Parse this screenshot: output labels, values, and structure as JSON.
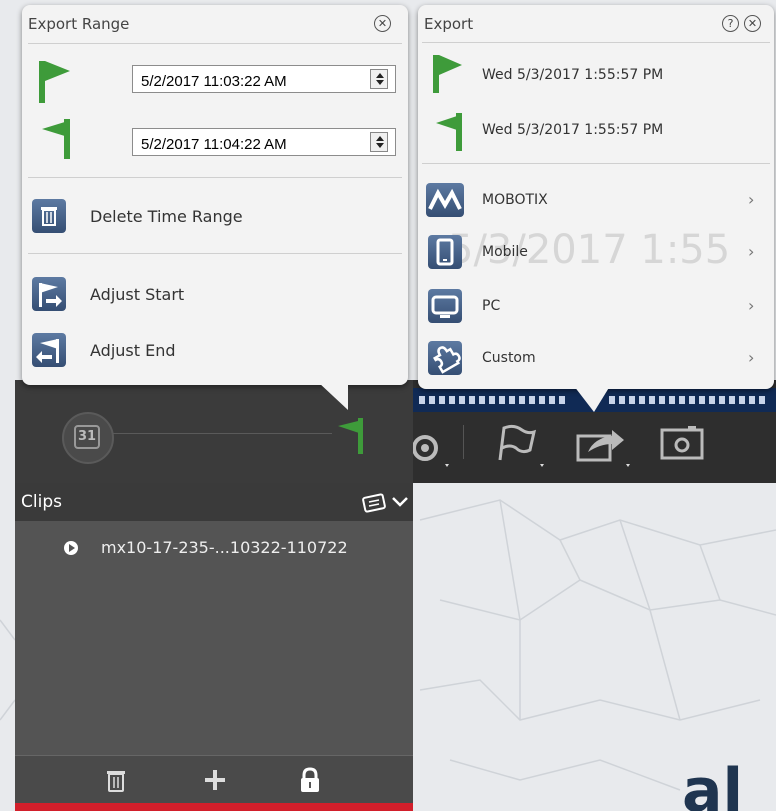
{
  "export_range": {
    "title": "Export Range",
    "start_value": "5/2/2017 11:03:22 AM",
    "end_value": "5/2/2017 11:04:22 AM",
    "delete_label": "Delete Time Range",
    "adjust_start_label": "Adjust Start",
    "adjust_end_label": "Adjust End"
  },
  "export": {
    "title": "Export",
    "start_time": "Wed 5/3/2017 1:55:57 PM",
    "end_time": "Wed 5/3/2017 1:55:57 PM",
    "items": [
      {
        "label": "MOBOTIX",
        "icon": "mobotix-icon"
      },
      {
        "label": "Mobile",
        "icon": "mobile-icon"
      },
      {
        "label": "PC",
        "icon": "pc-icon"
      },
      {
        "label": "Custom",
        "icon": "puzzle-icon"
      }
    ],
    "bg_timestamp": "5/3/2017 1:55"
  },
  "timeline": {
    "calendar_day": "31"
  },
  "clips": {
    "title": "Clips",
    "items": [
      {
        "name": "mx10-17-235-...10322-110722"
      }
    ]
  },
  "colors": {
    "flag_green": "#3e9b3a",
    "accent_blue": "#2f5d96",
    "clips_bg": "#545454",
    "red_bar": "#d21f2b"
  }
}
